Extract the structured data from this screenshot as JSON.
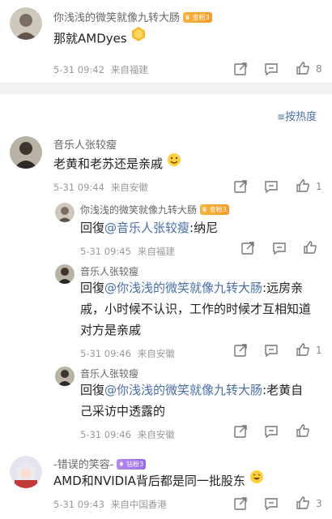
{
  "top_comment": {
    "user": "你浅浅的微笑就像九转大肠",
    "badge": "金粉3",
    "text": "那就AMDyes",
    "time": "5-31 09:42",
    "location": "来自福建",
    "likes": "8"
  },
  "sort_label": "按热度",
  "thread": {
    "main": {
      "user": "音乐人张较瘦",
      "text": "老黄和老苏还是亲戚",
      "time": "5-31 09:44",
      "location": "来自安徽",
      "likes": "1"
    },
    "replies": [
      {
        "user": "你浅浅的微笑就像九转大肠",
        "badge": "金粉3",
        "reply_prefix": "回復",
        "mention": "@音乐人张较瘦",
        "line1": ":纳尼",
        "time": "5-31 09:45",
        "location": "来自福建"
      },
      {
        "user": "音乐人张较瘦",
        "reply_prefix": "回復",
        "mention": "@你浅浅的微笑就像九转大肠",
        "line1": ":远房亲",
        "line2": "戚，小时候不认识，工作的时候才互相知道",
        "line3": "对方是亲戚",
        "time": "5-31 09:46",
        "location": "来自安徽",
        "likes": "1"
      },
      {
        "user": "音乐人张较瘦",
        "reply_prefix": "回復",
        "mention": "@你浅浅的微笑就像九转大肠",
        "line1": ":老黄自",
        "line2": "己采访中透露的",
        "time": "5-31 09:46",
        "location": "来自安徽"
      }
    ]
  },
  "bottom_comment": {
    "user": "-错误的笑容-",
    "badge": "钻粉3",
    "text": "AMD和NVIDIA背后都是同一批股东",
    "time": "5-31 09:43",
    "location": "来自中国香港",
    "likes": "3"
  },
  "colors": {
    "link": "#4a6fa5",
    "gold_badge": "#f5a733",
    "purple_badge": "#a77aee",
    "divider": "#f2f2f2"
  }
}
